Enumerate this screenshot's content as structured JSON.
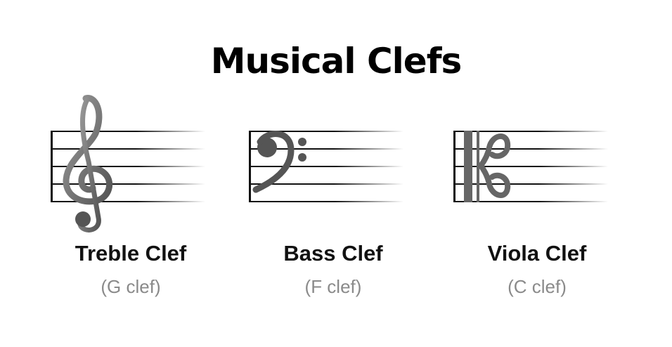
{
  "title": "Musical Clefs",
  "clefs": [
    {
      "name": "Treble Clef",
      "subtitle": "(G clef)",
      "icon": "treble-clef-icon"
    },
    {
      "name": "Bass Clef",
      "subtitle": "(F clef)",
      "icon": "bass-clef-icon"
    },
    {
      "name": "Viola Clef",
      "subtitle": "(C clef)",
      "icon": "alto-clef-icon"
    }
  ],
  "colors": {
    "clef": "#777777",
    "staff": "#111111",
    "subtitle": "#8a8a8a"
  }
}
